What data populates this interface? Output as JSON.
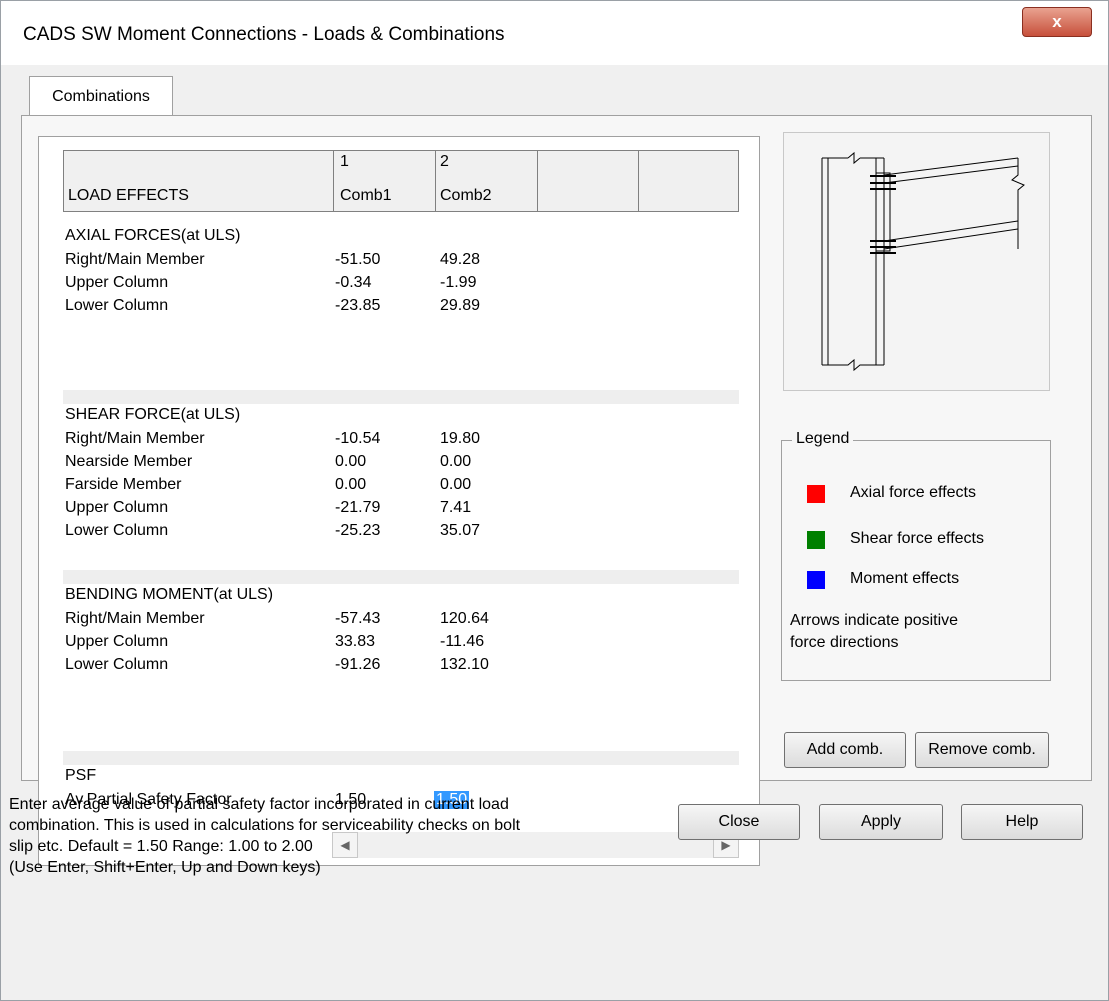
{
  "window": {
    "title": "CADS SW Moment Connections - Loads & Combinations",
    "close_glyph": "x"
  },
  "tab": {
    "label": "Combinations"
  },
  "grid": {
    "header_label": "LOAD EFFECTS",
    "columns": [
      {
        "number": "1",
        "name": "Comb1"
      },
      {
        "number": "2",
        "name": "Comb2"
      }
    ],
    "sections": {
      "axial": {
        "title": "AXIAL FORCES(at ULS)",
        "rows": [
          {
            "label": "Right/Main Member",
            "c1": "-51.50",
            "c2": "49.28"
          },
          {
            "label": "Upper Column",
            "c1": "-0.34",
            "c2": "-1.99"
          },
          {
            "label": "Lower Column",
            "c1": "-23.85",
            "c2": "29.89"
          }
        ]
      },
      "shear": {
        "title": "SHEAR FORCE(at ULS)",
        "rows": [
          {
            "label": "Right/Main Member",
            "c1": "-10.54",
            "c2": "19.80"
          },
          {
            "label": "Nearside Member",
            "c1": "0.00",
            "c2": "0.00"
          },
          {
            "label": "Farside Member",
            "c1": "0.00",
            "c2": "0.00"
          },
          {
            "label": "Upper Column",
            "c1": "-21.79",
            "c2": "7.41"
          },
          {
            "label": "Lower Column",
            "c1": "-25.23",
            "c2": "35.07"
          }
        ]
      },
      "bending": {
        "title": "BENDING MOMENT(at ULS)",
        "rows": [
          {
            "label": "Right/Main Member",
            "c1": "-57.43",
            "c2": "120.64"
          },
          {
            "label": "Upper Column",
            "c1": "33.83",
            "c2": "-11.46"
          },
          {
            "label": "Lower Column",
            "c1": "-91.26",
            "c2": "132.10"
          }
        ]
      },
      "psf": {
        "title": "PSF",
        "rows": [
          {
            "label": "Av.Partial Safety Factor",
            "c1": "1.50",
            "c2": "1.50"
          }
        ]
      }
    }
  },
  "legend": {
    "title": "Legend",
    "items": [
      {
        "label": "Axial force effects",
        "color": "#ff0000"
      },
      {
        "label": "Shear force effects",
        "color": "#008000"
      },
      {
        "label": "Moment effects",
        "color": "#0000ff"
      }
    ],
    "note_line1": "Arrows indicate positive",
    "note_line2": "force directions"
  },
  "buttons": {
    "add_comb": "Add comb.",
    "remove_comb": "Remove comb.",
    "close": "Close",
    "apply": "Apply",
    "help": "Help"
  },
  "status": {
    "line1": "Enter average value of partial safety factor incorporated in current load",
    "line2": "combination.    This is used in calculations for serviceability checks on bolt",
    "line3": "slip etc.    Default = 1.50  Range: 1.00 to 2.00",
    "line4": "(Use Enter, Shift+Enter, Up and Down keys)"
  },
  "scroll": {
    "left_glyph": "◀",
    "right_glyph": "▶"
  }
}
